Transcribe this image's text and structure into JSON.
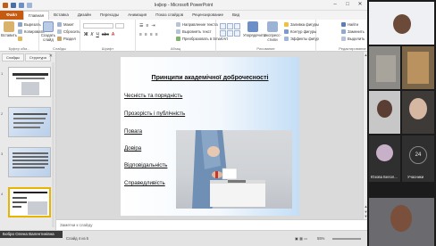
{
  "window": {
    "title": "Інфор - Microsoft PowerPoint",
    "controls": [
      "–",
      "□",
      "✕"
    ]
  },
  "ribbon_tabs": [
    "Файл",
    "Главная",
    "Вставка",
    "Дизайн",
    "Переходы",
    "Анимация",
    "Показ слайдов",
    "Рецензирование",
    "Вид"
  ],
  "ribbon": {
    "paste_label": "Вставить",
    "clipboard_group": "Буфер обм...",
    "cut_label": "Вырезать",
    "copy_label": "Копировать",
    "new_slide_label": "Создать слайд",
    "layout_label": "Макет",
    "reset_label": "Сбросить",
    "section_label": "Раздел",
    "slides_group": "Слайды",
    "font_group": "Шрифт",
    "paragraph_group": "Абзац",
    "text_dir_label": "Направление текста",
    "align_text_label": "Выровнять текст",
    "smartart_label": "Преобразовать в SmartArt",
    "drawing_group": "Рисование",
    "arrange_label": "Упорядочить",
    "quick_styles_label": "Экспресс-стили",
    "shape_fill_label": "Заливка фигуры",
    "shape_outline_label": "Контур фигуры",
    "shape_effects_label": "Эффекты фигур",
    "find_label": "Найти",
    "replace_label": "Заменить",
    "select_label": "Выделить",
    "editing_group": "Редактирование"
  },
  "left_pane": {
    "tab_slides": "Слайды",
    "tab_outline": "Структура",
    "close": "✕",
    "slide_numbers": [
      "1",
      "2",
      "3",
      "4"
    ],
    "selected_index": 4
  },
  "slide": {
    "title": "Принципи академічної доброчесності",
    "items": [
      "Чесність та порядність",
      "Прозорість і публічність",
      "Повага",
      "Довіра",
      "Відповідальність",
      "Справедливість"
    ]
  },
  "notes": {
    "placeholder": "Заметки к слайду"
  },
  "status": {
    "speaker": "Бобро Олена Валентинівна",
    "slide_info": "Слайд 4 из 5",
    "zoom": "55%"
  },
  "participants": [
    {
      "name": ""
    },
    {
      "name": ""
    },
    {
      "name": ""
    },
    {
      "name": ""
    },
    {
      "name": "Юзова Белол..."
    },
    {
      "name": "Учасники",
      "count": "24"
    },
    {
      "name": ""
    }
  ],
  "colors": {
    "file_tab": "#c55a11",
    "selection": "#e7b400",
    "slide_gradient_edge": "#c4def6"
  }
}
